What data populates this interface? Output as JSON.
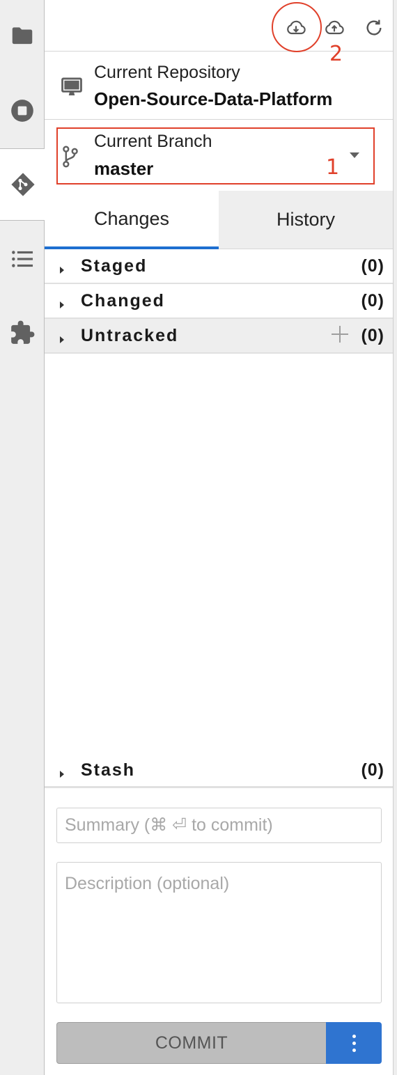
{
  "activity_bar": {
    "items": [
      {
        "icon": "folder-icon"
      },
      {
        "icon": "stop-circle-icon"
      },
      {
        "icon": "git-icon",
        "active": true
      },
      {
        "icon": "list-icon"
      },
      {
        "icon": "puzzle-icon"
      }
    ]
  },
  "toolbar": {
    "pull_icon": "cloud-download-icon",
    "push_icon": "cloud-upload-icon",
    "refresh_icon": "refresh-icon"
  },
  "annotations": {
    "branch_marker": "1",
    "pull_marker": "2",
    "color": "#e0402a"
  },
  "repository": {
    "label": "Current Repository",
    "name": "Open-Source-Data-Platform"
  },
  "branch": {
    "label": "Current Branch",
    "name": "master"
  },
  "tabs": {
    "changes": "Changes",
    "history": "History",
    "active": "Changes"
  },
  "sections": {
    "staged": {
      "label": "Staged",
      "count": "(0)"
    },
    "changed": {
      "label": "Changed",
      "count": "(0)"
    },
    "untracked": {
      "label": "Untracked",
      "count": "(0)"
    },
    "stash": {
      "label": "Stash",
      "count": "(0)"
    }
  },
  "commit_form": {
    "summary_placeholder": "Summary (⌘ ⏎ to commit)",
    "description_placeholder": "Description (optional)",
    "commit_label": "COMMIT"
  },
  "colors": {
    "accent": "#1e6fd0",
    "commit_menu": "#2f74d0"
  }
}
